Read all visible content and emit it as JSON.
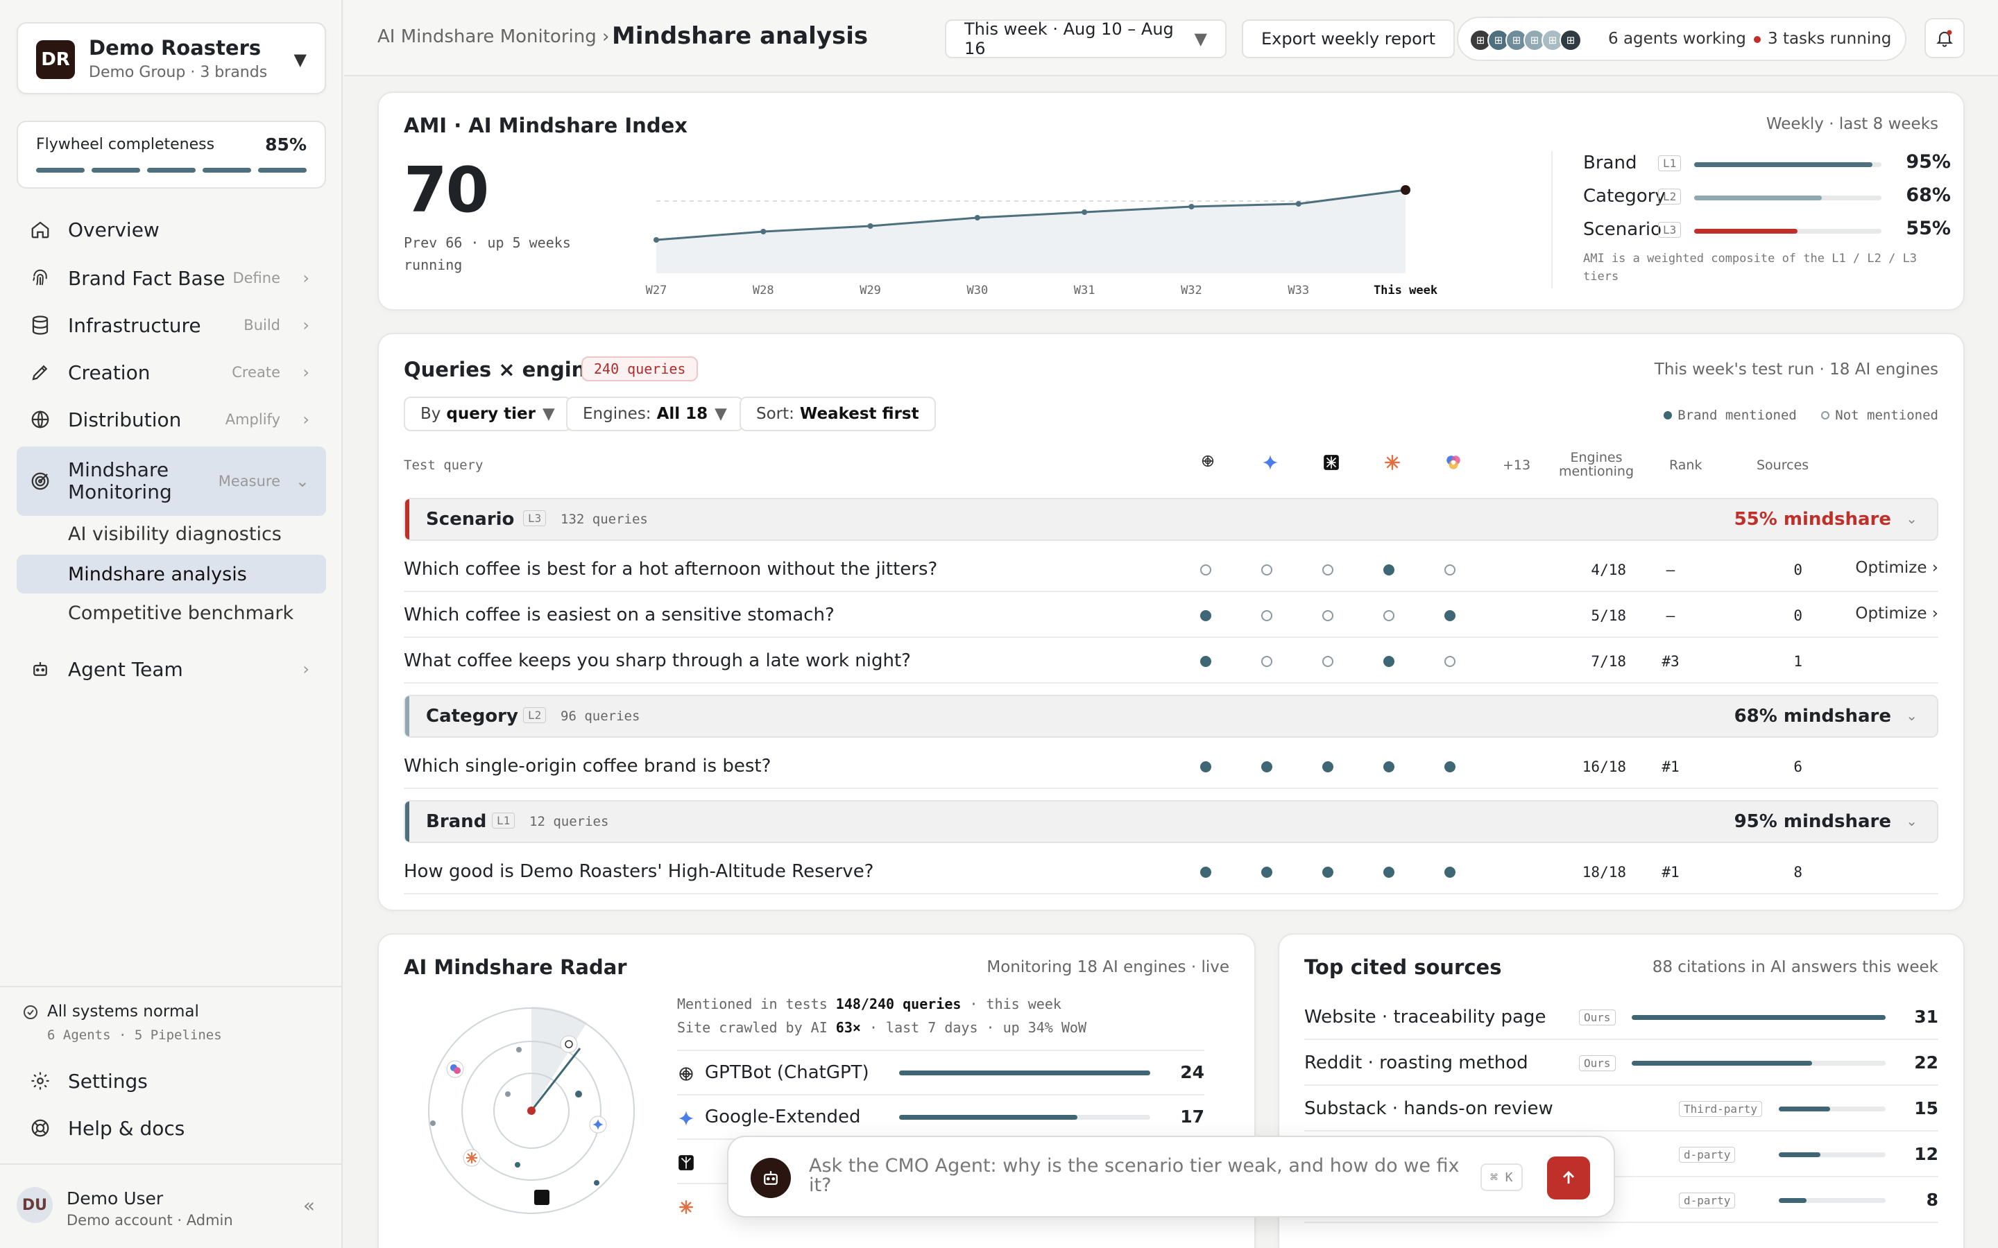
{
  "sidebar": {
    "brand": {
      "initials": "DR",
      "name": "Demo Roasters",
      "sub": "Demo Group · 3 brands"
    },
    "flywheel": {
      "label": "Flywheel completeness",
      "value": "85%",
      "segments": 5
    },
    "nav": [
      {
        "label": "Overview",
        "tag": "",
        "icon": "home-icon"
      },
      {
        "label": "Brand Fact Base",
        "tag": "Define",
        "icon": "fingerprint-icon"
      },
      {
        "label": "Infrastructure",
        "tag": "Build",
        "icon": "database-icon"
      },
      {
        "label": "Creation",
        "tag": "Create",
        "icon": "pen-icon"
      },
      {
        "label": "Distribution",
        "tag": "Amplify",
        "icon": "globe-icon"
      },
      {
        "label": "Mindshare Monitoring",
        "tag": "Measure",
        "icon": "target-icon"
      }
    ],
    "sub": [
      "AI visibility diagnostics",
      "Mindshare analysis",
      "Competitive benchmark"
    ],
    "agent_team": "Agent Team",
    "status": {
      "title": "All systems normal",
      "sub": "6 Agents · 5 Pipelines"
    },
    "settings": "Settings",
    "help": "Help & docs",
    "user": {
      "initials": "DU",
      "name": "Demo User",
      "sub": "Demo account · Admin"
    }
  },
  "header": {
    "crumb": "AI Mindshare Monitoring ›",
    "title": "Mindshare analysis",
    "date": "This week · Aug 10 – Aug 16",
    "export": "Export weekly report",
    "agents": "6 agents working",
    "tasks": "3 tasks running"
  },
  "ami": {
    "title": "AMI · AI Mindshare Index",
    "meta": "Weekly · last 8 weeks",
    "value": "70",
    "prev": "Prev 66 · up 5 weeks running",
    "tiers": [
      {
        "name": "Brand",
        "tag": "L1",
        "value": "95%",
        "pct": 95,
        "color": "#4d6f7e"
      },
      {
        "name": "Category",
        "tag": "L2",
        "value": "68%",
        "pct": 68,
        "color": "#8fa7b0"
      },
      {
        "name": "Scenario",
        "tag": "L3",
        "value": "55%",
        "pct": 55,
        "color": "#c0302b"
      }
    ],
    "footnote": "AMI is a weighted composite of the L1 / L2 / L3 tiers"
  },
  "chart_data": {
    "type": "line",
    "categories": [
      "W27",
      "W28",
      "W29",
      "W30",
      "W31",
      "W32",
      "W33",
      "This week"
    ],
    "values": [
      52,
      55,
      57,
      60,
      62,
      64,
      65,
      70
    ],
    "ylim": [
      40,
      75
    ]
  },
  "queries": {
    "title": "Queries × engines",
    "tag": "240 queries",
    "meta": "This week's test run · 18 AI engines",
    "filters": [
      {
        "label": "By",
        "value": "query tier"
      },
      {
        "label": "Engines:",
        "value": "All 18"
      },
      {
        "label": "Sort:",
        "value": "Weakest first"
      }
    ],
    "legend_on": "Brand mentioned",
    "legend_off": "Not mentioned",
    "col_query": "Test query",
    "col_more": "+13",
    "col_mentioning": "Engines mentioning",
    "col_rank": "Rank",
    "col_sources": "Sources",
    "groups": [
      {
        "name": "Scenario",
        "tag": "L3",
        "count": "132 queries",
        "mindshare": "55% mindshare",
        "color": "#c0302b",
        "rows": [
          {
            "q": "Which coffee is best for a hot afternoon without the jitters?",
            "dots": [
              0,
              0,
              0,
              1,
              0
            ],
            "eng": "4/18",
            "rank": "–",
            "src": "0",
            "action": "Optimize ›"
          },
          {
            "q": "Which coffee is easiest on a sensitive stomach?",
            "dots": [
              1,
              0,
              0,
              0,
              1
            ],
            "eng": "5/18",
            "rank": "–",
            "src": "0",
            "action": "Optimize ›"
          },
          {
            "q": "What coffee keeps you sharp through a late work night?",
            "dots": [
              1,
              0,
              0,
              1,
              0
            ],
            "eng": "7/18",
            "rank": "#3",
            "src": "1",
            "action": ""
          }
        ]
      },
      {
        "name": "Category",
        "tag": "L2",
        "count": "96 queries",
        "mindshare": "68% mindshare",
        "color": "#8fa7b0",
        "rows": [
          {
            "q": "Which single-origin coffee brand is best?",
            "dots": [
              1,
              1,
              1,
              1,
              1
            ],
            "eng": "16/18",
            "rank": "#1",
            "src": "6",
            "action": ""
          }
        ]
      },
      {
        "name": "Brand",
        "tag": "L1",
        "count": "12 queries",
        "mindshare": "95% mindshare",
        "color": "#4d6f7e",
        "rows": [
          {
            "q": "How good is Demo Roasters' High-Altitude Reserve?",
            "dots": [
              1,
              1,
              1,
              1,
              1
            ],
            "eng": "18/18",
            "rank": "#1",
            "src": "8",
            "action": ""
          }
        ]
      }
    ]
  },
  "radar": {
    "title": "AI Mindshare Radar",
    "meta": "Monitoring 18 AI engines · live",
    "stat1": {
      "pre": "Mentioned in tests ",
      "bold": "148/240 queries",
      "post": " · this week"
    },
    "stat2": {
      "pre": "Site crawled by AI ",
      "bold": "63×",
      "post": " · last 7 days · up 34% WoW"
    },
    "crawlers": [
      {
        "name": "GPTBot (ChatGPT)",
        "value": "24",
        "pct": 1.0
      },
      {
        "name": "Google-Extended",
        "value": "17",
        "pct": 0.71
      },
      {
        "name": "",
        "value": "",
        "pct": 0.5
      },
      {
        "name": "",
        "value": "",
        "pct": 0.3
      }
    ]
  },
  "sources": {
    "title": "Top cited sources",
    "meta": "88 citations in AI answers this week",
    "rows": [
      {
        "name": "Website · traceability page",
        "tag": "Ours",
        "value": "31",
        "pct": 1.0
      },
      {
        "name": "Reddit · roasting method",
        "tag": "Ours",
        "value": "22",
        "pct": 0.71
      },
      {
        "name": "Substack · hands-on review",
        "tag": "Third-party",
        "value": "15",
        "pct": 0.48
      },
      {
        "name": "",
        "tag": "d-party",
        "value": "12",
        "pct": 0.39
      },
      {
        "name": "",
        "tag": "d-party",
        "value": "8",
        "pct": 0.26
      }
    ]
  },
  "chat": {
    "placeholder": "Ask the CMO Agent: why is the scenario tier weak, and how do we fix it?",
    "shortcut": "⌘ K"
  }
}
